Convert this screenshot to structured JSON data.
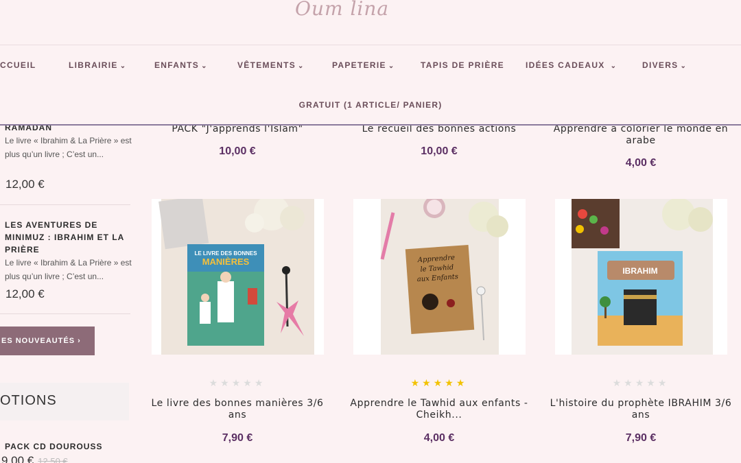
{
  "header": {
    "logo_text": "Oum lina",
    "nav": [
      {
        "label": "CCUEIL",
        "chevron": false
      },
      {
        "label": "LIBRAIRIE",
        "chevron": true
      },
      {
        "label": "ENFANTS",
        "chevron": true
      },
      {
        "label": "VÊTEMENTS",
        "chevron": true
      },
      {
        "label": "PAPETERIE",
        "chevron": true
      },
      {
        "label": "TAPIS DE PRIÈRE",
        "chevron": false
      },
      {
        "label": "IDÉES CADEAUX",
        "chevron": true
      },
      {
        "label": "DIVERS",
        "chevron": true
      }
    ],
    "promo_text": "GRATUIT (1 ARTICLE/ PANIER)"
  },
  "sidebar": {
    "items": [
      {
        "title": "RAMADAN",
        "desc": "  Le livre « Ibrahim & La Prière » est plus qu’un livre ; C’est un...",
        "price": "12,00 €"
      },
      {
        "title": "LES AVENTURES DE MINIMUZ : IBRAHIM ET LA PRIÈRE",
        "desc": "Le livre « Ibrahim & La Prière » est plus qu’un livre ; C’est un...",
        "price": "12,00 €"
      }
    ],
    "new_button": "ES NOUVEAUTÉS ›",
    "promo_heading": "OTIONS",
    "promo_item": {
      "title": "PACK CD DOUROUSS",
      "price": "9,00 €",
      "old_price": "12,50 €"
    }
  },
  "products_top": [
    {
      "title": "PACK \"J'apprends l'Islam\"",
      "price": "10,00 €"
    },
    {
      "title": "Le recueil des bonnes actions",
      "price": "10,00 €"
    },
    {
      "title": "Apprendre à colorier le monde en arabe",
      "price": "4,00 €"
    }
  ],
  "products": [
    {
      "title": "Le livre des bonnes manières 3/6 ans",
      "price": "7,90 €",
      "rating": 0,
      "cover_text": "LE LIVRE DES BONNES MANIÈRES"
    },
    {
      "title": "Apprendre le Tawhid aux enfants - Cheikh...",
      "price": "4,00 €",
      "rating": 5,
      "cover_text": "Apprendre le Tawhid aux Enfants"
    },
    {
      "title": "L'histoire du prophète IBRAHIM 3/6 ans",
      "price": "7,90 €",
      "rating": 0,
      "cover_text": "IBRAHIM"
    }
  ],
  "colors": {
    "accent": "#5b2f63",
    "button": "#8d6b78",
    "background": "#fcf2f3",
    "star": "#f2c200"
  }
}
